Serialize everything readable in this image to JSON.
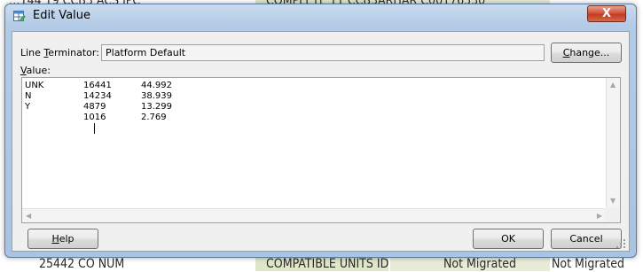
{
  "background": {
    "top_row": [
      "…144 19 CCB3 ACS IPC",
      "COMPLETE 11 CCB3ARHAR C00176530"
    ],
    "bottom_row": [
      "25442 CO NUM",
      "COMPATIBLE UNITS ID",
      "Not Migrated",
      "Not Migrated"
    ]
  },
  "dialog": {
    "title": "Edit Value",
    "close_symbol": "X",
    "line_terminator_label_prefix": "Line ",
    "line_terminator_label_mnemonic": "T",
    "line_terminator_label_suffix": "erminator:",
    "line_terminator_value": "Platform Default",
    "change_button": {
      "mnemonic": "C",
      "rest": "hange..."
    },
    "value_label": {
      "mnemonic": "V",
      "rest": "alue:"
    },
    "value_lines": [
      {
        "c1": "UNK",
        "c2": "16441",
        "c3": "44.992"
      },
      {
        "c1": "N",
        "c2": "14234",
        "c3": "38.939"
      },
      {
        "c1": "Y",
        "c2": "4879",
        "c3": "13.299"
      },
      {
        "c1": "",
        "c2": "1016",
        "c3": "2.769"
      }
    ],
    "help_button": {
      "mnemonic": "H",
      "rest": "elp"
    },
    "ok_button": "OK",
    "cancel_button": "Cancel"
  },
  "colors": {
    "frame": "#b3cbe6",
    "close": "#c23a22",
    "highlight_column": "#dfe7c9"
  }
}
